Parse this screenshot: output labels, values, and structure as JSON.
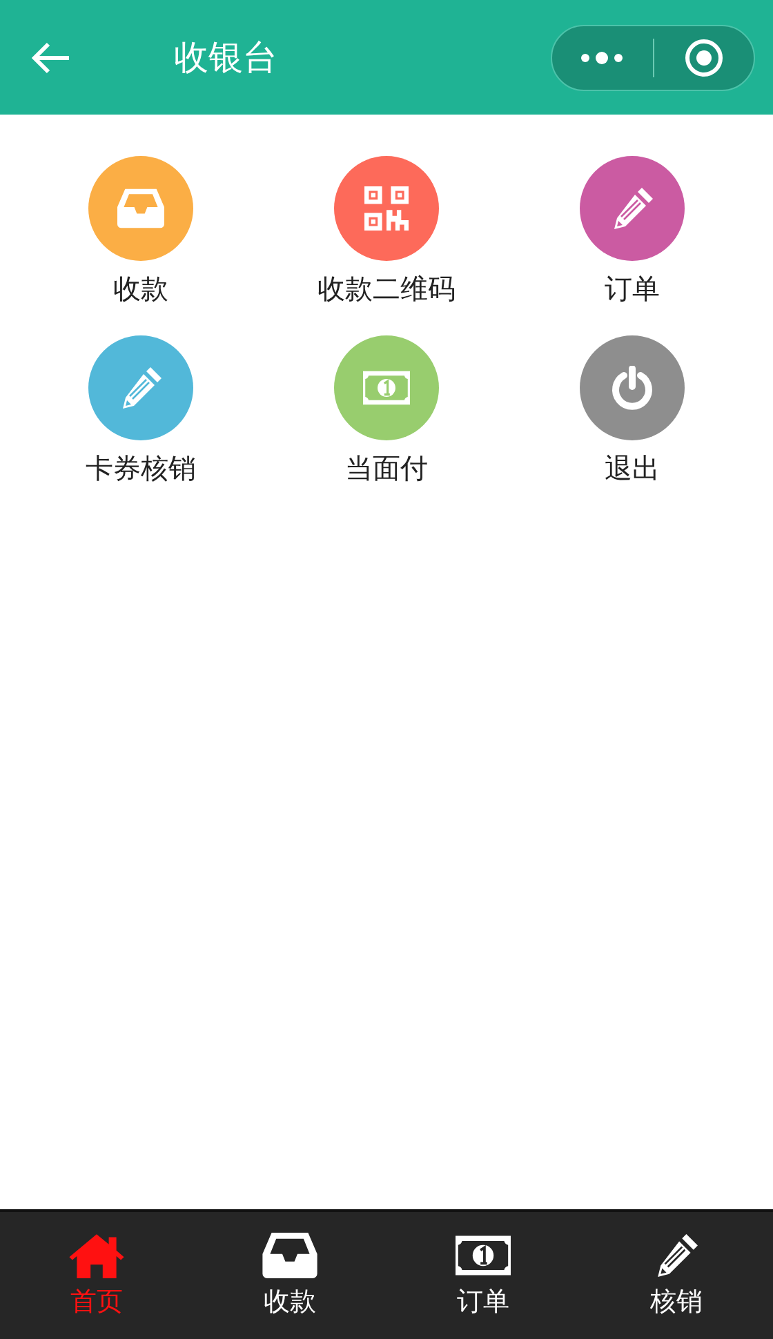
{
  "header": {
    "title": "收银台"
  },
  "grid": [
    {
      "label": "收款",
      "kind": "tray",
      "color": "#fbae45"
    },
    {
      "label": "收款二维码",
      "kind": "qrcode",
      "color": "#fd6a5a"
    },
    {
      "label": "订单",
      "kind": "pencil",
      "color": "#cb5ba2"
    },
    {
      "label": "卡券核销",
      "kind": "pencil",
      "color": "#52b8d9"
    },
    {
      "label": "当面付",
      "kind": "money",
      "color": "#98cd6e"
    },
    {
      "label": "退出",
      "kind": "power",
      "color": "#8e8e8e"
    }
  ],
  "tab_bar": [
    {
      "label": "首页",
      "kind": "home",
      "selected": true
    },
    {
      "label": "收款",
      "kind": "tray",
      "selected": false
    },
    {
      "label": "订单",
      "kind": "money",
      "selected": false
    },
    {
      "label": "核销",
      "kind": "pencil",
      "selected": false
    }
  ]
}
